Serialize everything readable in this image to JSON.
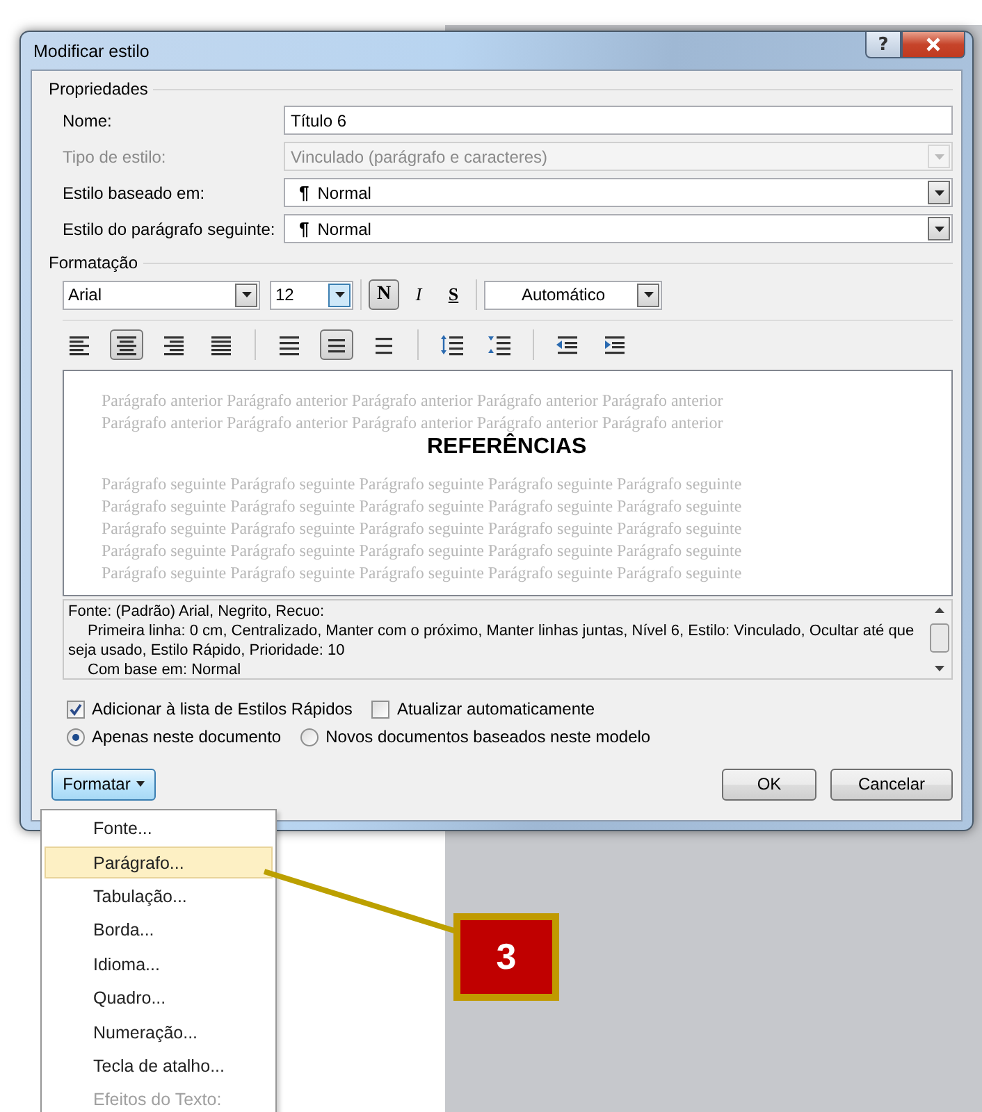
{
  "window": {
    "title": "Modificar estilo",
    "help": "?"
  },
  "properties": {
    "label": "Propriedades",
    "fields": [
      {
        "label": "Nome:",
        "kind": "text",
        "value": "Título 6",
        "disabled": false
      },
      {
        "label": "Tipo de estilo:",
        "kind": "select",
        "value": "Vinculado (parágrafo e caracteres)",
        "disabled": true
      },
      {
        "label": "Estilo baseado em:",
        "kind": "select",
        "mark": "¶",
        "value": "Normal",
        "disabled": false
      },
      {
        "label": "Estilo do parágrafo seguinte:",
        "kind": "select",
        "mark": "¶",
        "value": "Normal",
        "disabled": false
      }
    ]
  },
  "formatting": {
    "label": "Formatação",
    "font": "Arial",
    "size": "12",
    "font_color": "Automático",
    "styles": [
      {
        "kind": "bold",
        "glyph": "N",
        "selected": true
      },
      {
        "kind": "italic",
        "glyph": "I",
        "selected": false
      },
      {
        "kind": "underline",
        "glyph": "S",
        "selected": false
      }
    ],
    "paragraph_tool_groups": [
      [
        {
          "kind": "align-left",
          "selected": false
        },
        {
          "kind": "align-center",
          "selected": true
        },
        {
          "kind": "align-right",
          "selected": false
        },
        {
          "kind": "justify",
          "selected": false
        }
      ],
      [
        {
          "kind": "single-spacing",
          "selected": false
        },
        {
          "kind": "one-half-spacing",
          "selected": true
        },
        {
          "kind": "double-spacing",
          "selected": false
        }
      ],
      [
        {
          "kind": "space-before",
          "selected": false
        },
        {
          "kind": "space-after",
          "selected": false
        }
      ],
      [
        {
          "kind": "indent-decrease",
          "selected": false
        },
        {
          "kind": "indent-increase",
          "selected": false
        }
      ]
    ]
  },
  "preview": {
    "previous_lines": [
      "Parágrafo anterior Parágrafo anterior Parágrafo anterior Parágrafo anterior Parágrafo anterior",
      "Parágrafo anterior Parágrafo anterior Parágrafo anterior Parágrafo anterior Parágrafo anterior"
    ],
    "heading": "REFERÊNCIAS",
    "next_lines": [
      "Parágrafo seguinte Parágrafo seguinte Parágrafo seguinte Parágrafo seguinte Parágrafo seguinte",
      "Parágrafo seguinte Parágrafo seguinte Parágrafo seguinte Parágrafo seguinte Parágrafo seguinte",
      "Parágrafo seguinte Parágrafo seguinte Parágrafo seguinte Parágrafo seguinte Parágrafo seguinte",
      "Parágrafo seguinte Parágrafo seguinte Parágrafo seguinte Parágrafo seguinte Parágrafo seguinte",
      "Parágrafo seguinte Parágrafo seguinte Parágrafo seguinte Parágrafo seguinte Parágrafo seguinte"
    ]
  },
  "description": {
    "lines": [
      "Fonte: (Padrão) Arial, Negrito, Recuo:",
      "Primeira linha:  0 cm, Centralizado, Manter com o próximo, Manter linhas juntas, Nível 6, Estilo: Vinculado, Ocultar até que seja usado, Estilo Rápido, Prioridade: 10",
      "Com base em: Normal"
    ]
  },
  "options": {
    "checkboxes": [
      {
        "label": "Adicionar à lista de Estilos Rápidos",
        "checked": true
      },
      {
        "label": "Atualizar automaticamente",
        "checked": false
      }
    ],
    "radios": [
      {
        "label": "Apenas neste documento",
        "selected": true
      },
      {
        "label": "Novos documentos baseados neste modelo",
        "selected": false
      }
    ]
  },
  "buttons": {
    "format": "Formatar",
    "ok": "OK",
    "cancel": "Cancelar"
  },
  "format_menu": {
    "items": [
      {
        "label": "Fonte...",
        "highlighted": false,
        "disabled": false
      },
      {
        "label": "Parágrafo...",
        "highlighted": true,
        "disabled": false
      },
      {
        "label": "Tabulação...",
        "highlighted": false,
        "disabled": false
      },
      {
        "label": "Borda...",
        "highlighted": false,
        "disabled": false
      },
      {
        "label": "Idioma...",
        "highlighted": false,
        "disabled": false
      },
      {
        "label": "Quadro...",
        "highlighted": false,
        "disabled": false
      },
      {
        "label": "Numeração...",
        "highlighted": false,
        "disabled": false
      },
      {
        "label": "Tecla de atalho...",
        "highlighted": false,
        "disabled": false
      },
      {
        "label": "Efeitos do Texto:",
        "highlighted": false,
        "disabled": true
      }
    ]
  },
  "callout": {
    "number": "3"
  }
}
